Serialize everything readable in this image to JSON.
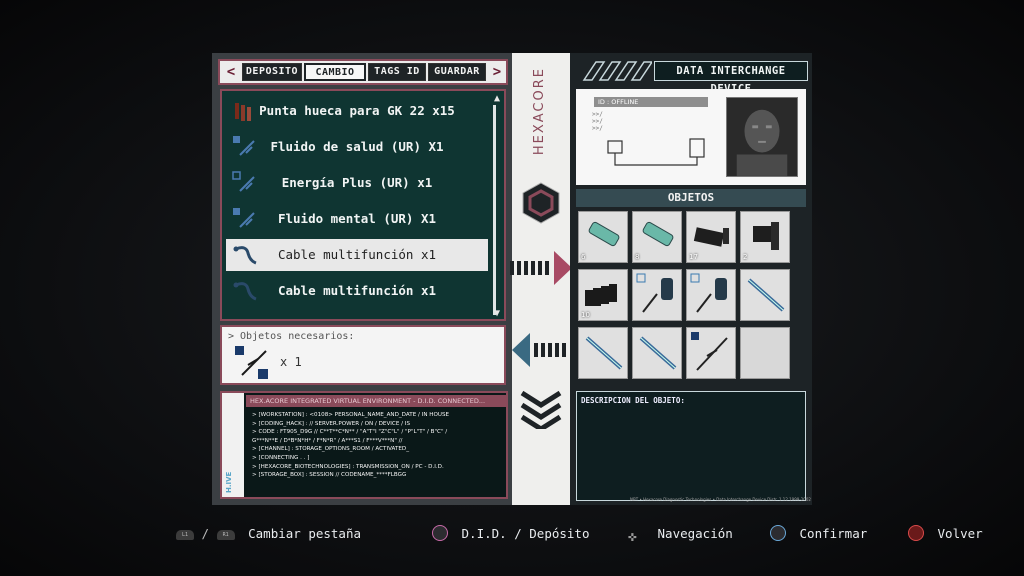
{
  "tabs": [
    {
      "label": "DEPOSITO",
      "active": false
    },
    {
      "label": "CAMBIO",
      "active": true
    },
    {
      "label": "TAGS ID",
      "active": false
    },
    {
      "label": "GUARDAR",
      "active": false
    }
  ],
  "items": [
    {
      "label": "Punta hueca para GK 22 x15",
      "icon": "bullets-icon",
      "selected": false
    },
    {
      "label": "Fluido de salud (UR) X1",
      "icon": "syringe-icon",
      "selected": false
    },
    {
      "label": "Energía Plus (UR) x1",
      "icon": "syringe-icon",
      "selected": false
    },
    {
      "label": "Fluido mental (UR) X1",
      "icon": "syringe-icon",
      "selected": false
    },
    {
      "label": "Cable multifunción x1",
      "icon": "cable-icon",
      "selected": true
    },
    {
      "label": "Cable multifunción x1",
      "icon": "cable-icon",
      "selected": false
    }
  ],
  "needs": {
    "title": "> Objetos necesarios:",
    "quantity": "x 1",
    "icon": "syringe-icon"
  },
  "console": {
    "header": "HEX.ACORE INTEGRATED VIRTUAL ENVIRONMENT - D.I.D. CONNECTED...",
    "side_logo": "H.IVE",
    "lines": [
      "> [WORKSTATION] : <0108>    PERSONAL_NAME_AND_DATE / IN HOUSE",
      "> [CODING_HACK] : // SERVER.POWER / ON / DEVICE / IS",
      "> CODE : FT905_D9G // C**T**C*N** / \"A\"T\"I \"Z\"C\"L\" / \"P\"L\"T\" / B\"C\" /",
      "           G***N**E / D*B*N*H* / F*N*R\" / A***S1 / F***V***N\" //",
      "> [CHANNEL] : STORAGE_OPTIONS_ROOM / ACTIVATED_",
      "> [CONNECTING . . ]",
      "",
      "> [HEXACORE_BIOTECHNOLOGIES] : TRANSMISSION_ON / PC - D.I.D.",
      "> [STORAGE_BOX] : SESSION // CODENAME_****FLBGG"
    ]
  },
  "center": {
    "brand": "HEXACORE"
  },
  "did": {
    "title": "DATA INTERCHANGE DEVICE",
    "id_label": "ID : OFFLINE",
    "id_arrows": [
      ">>/",
      ">>/",
      ">>/"
    ]
  },
  "objects": {
    "title": "OBJETOS",
    "cells": [
      {
        "icon": "green-syringe-icon",
        "count": "6"
      },
      {
        "icon": "green-syringe-icon",
        "count": "8"
      },
      {
        "icon": "ammo-case-icon",
        "count": "17"
      },
      {
        "icon": "grenade-icon",
        "count": "2"
      },
      {
        "icon": "magazine-icon",
        "count": "10"
      },
      {
        "icon": "potion-syringe-icon",
        "count": ""
      },
      {
        "icon": "potion-syringe-icon",
        "count": ""
      },
      {
        "icon": "injector-icon",
        "count": ""
      },
      {
        "icon": "injector-icon",
        "count": ""
      },
      {
        "icon": "injector-icon",
        "count": ""
      },
      {
        "icon": "syringe-icon",
        "count": ""
      },
      {
        "icon": "",
        "count": ""
      }
    ]
  },
  "description": {
    "title": "DESCRIPCION DEL OBJETO:",
    "footer": "NBT • Hexacore Diagnostic Technologies • Data Interchange Device Distr. 1.12 1999-2002"
  },
  "hints": [
    {
      "label": "Cambiar pestaña",
      "button": "L1 / R1"
    },
    {
      "label": "D.I.D. / Depósito",
      "button": "square-button"
    },
    {
      "label": "Navegación",
      "button": "dpad"
    },
    {
      "label": "Confirmar",
      "button": "cross-button"
    },
    {
      "label": "Volver",
      "button": "circle-button"
    }
  ],
  "colors": {
    "accent": "#8a4a5a",
    "list_bg": "#0f3532",
    "right_bg": "#1d2326"
  }
}
